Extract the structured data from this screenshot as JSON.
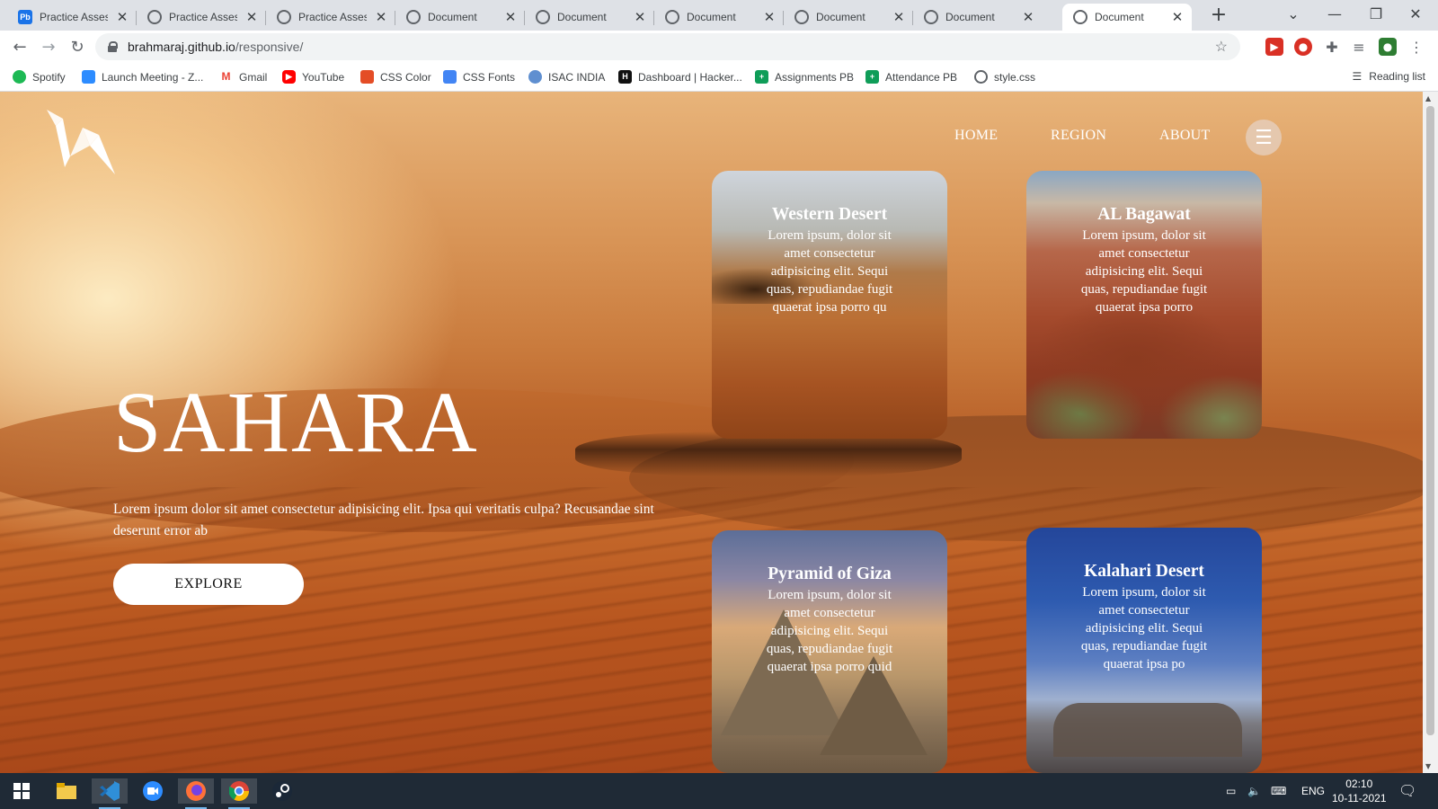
{
  "browser": {
    "tabs": [
      {
        "title": "Practice Assessm",
        "favicon": "pb-icon"
      },
      {
        "title": "Practice Assessm",
        "favicon": "globe-icon"
      },
      {
        "title": "Practice Assessm",
        "favicon": "globe-icon"
      },
      {
        "title": "Document",
        "favicon": "globe-icon"
      },
      {
        "title": "Document",
        "favicon": "globe-icon"
      },
      {
        "title": "Document",
        "favicon": "globe-icon"
      },
      {
        "title": "Document",
        "favicon": "globe-icon"
      },
      {
        "title": "Document",
        "favicon": "globe-icon"
      },
      {
        "title": "Document",
        "favicon": "globe-icon",
        "active": true
      }
    ],
    "url_host": "brahmaraj.github.io",
    "url_path": "/responsive/",
    "bookmarks": [
      {
        "label": "Spotify",
        "icon": "spotify-icon",
        "color": "#1db954"
      },
      {
        "label": "Launch Meeting - Z...",
        "icon": "zoom-icon",
        "color": "#2d8cff"
      },
      {
        "label": "Gmail",
        "icon": "gmail-icon",
        "color": "#ea4335"
      },
      {
        "label": "YouTube",
        "icon": "youtube-icon",
        "color": "#ff0000"
      },
      {
        "label": "CSS Color",
        "icon": "css-icon",
        "color": "#e44d26"
      },
      {
        "label": "CSS Fonts",
        "icon": "fonts-icon",
        "color": "#4285f4"
      },
      {
        "label": "ISAC INDIA",
        "icon": "isac-icon",
        "color": "#5f8fd0"
      },
      {
        "label": "Dashboard | Hacker...",
        "icon": "hackerrank-icon",
        "color": "#111111"
      },
      {
        "label": "Assignments PB",
        "icon": "sheets-icon",
        "color": "#0f9d58"
      },
      {
        "label": "Attendance PB",
        "icon": "sheets-icon",
        "color": "#0f9d58"
      },
      {
        "label": "style.css",
        "icon": "globe-icon",
        "color": "#5f6368"
      }
    ],
    "reading_list": "Reading list"
  },
  "page": {
    "nav": {
      "home": "HOME",
      "region": "REGION",
      "about": "ABOUT"
    },
    "menu_icon": "☰",
    "hero": {
      "title": "SAHARA",
      "text": "Lorem ipsum dolor sit amet consectetur adipisicing elit. Ipsa qui veritatis culpa? Recusandae sint deserunt error ab",
      "button": "EXPLORE"
    },
    "cards": [
      {
        "title": "Western Desert",
        "text": "Lorem ipsum, dolor sit amet consectetur adipisicing elit. Sequi quas, repudiandae fugit quaerat ipsa porro qu"
      },
      {
        "title": "AL Bagawat",
        "text": "Lorem ipsum, dolor sit amet consectetur adipisicing elit. Sequi quas, repudiandae fugit quaerat ipsa porro"
      },
      {
        "title": "Pyramid of Giza",
        "text": "Lorem ipsum, dolor sit amet consectetur adipisicing elit. Sequi quas, repudiandae fugit quaerat ipsa porro quid"
      },
      {
        "title": "Kalahari Desert",
        "text": "Lorem ipsum, dolor sit amet consectetur adipisicing elit. Sequi quas, repudiandae fugit quaerat ipsa po"
      }
    ]
  },
  "taskbar": {
    "apps": [
      "windows-start-icon",
      "file-explorer-icon",
      "vscode-icon",
      "zoom-icon",
      "firefox-icon",
      "chrome-icon",
      "steam-icon"
    ],
    "language": "ENG",
    "time": "02:10",
    "date": "10-11-2021"
  }
}
